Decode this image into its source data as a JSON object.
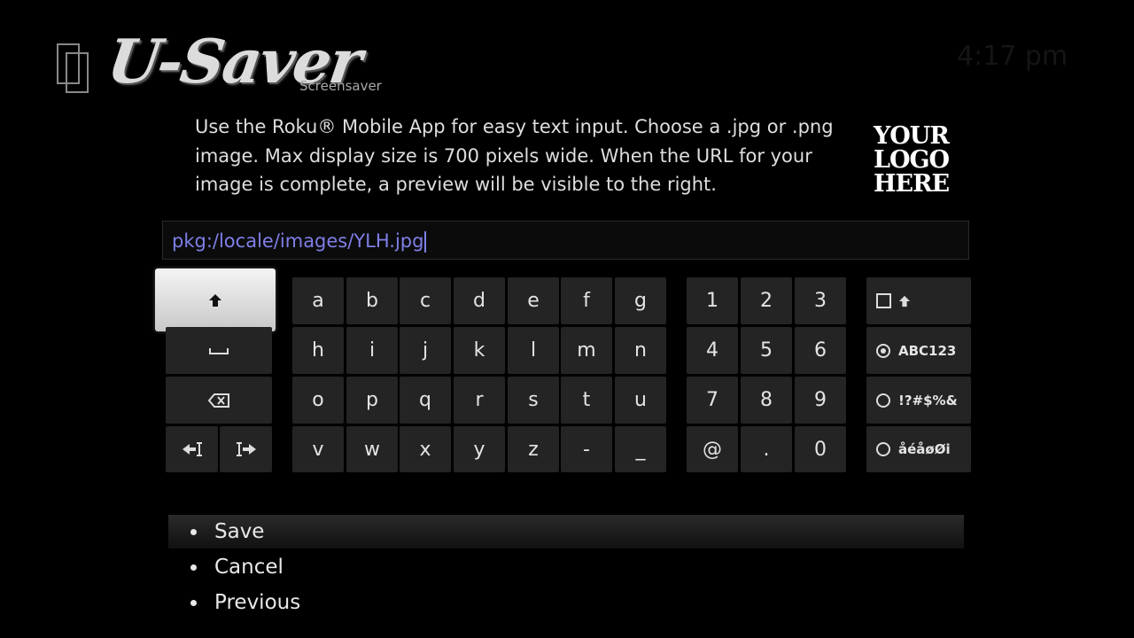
{
  "header": {
    "title": "U-Saver",
    "subtitle": "Screensaver",
    "clock": "4:17 pm"
  },
  "description": "Use the Roku® Mobile App for easy text input. Choose a .jpg or .png image. Max display size is 700 pixels wide. When the URL for your image is complete, a preview will be visible to the right.",
  "preview": {
    "lines": [
      "YOUR",
      "LOGO",
      "HERE"
    ]
  },
  "url_input": {
    "value": "pkg:/locale/images/YLH.jpg"
  },
  "keyboard": {
    "control_keys": {
      "shift": "⬆",
      "space": "⎵",
      "backspace": "⌫",
      "cursor_left": "⇤",
      "cursor_right": "⇥"
    },
    "letters": [
      [
        "a",
        "b",
        "c",
        "d",
        "e",
        "f",
        "g"
      ],
      [
        "h",
        "i",
        "j",
        "k",
        "l",
        "m",
        "n"
      ],
      [
        "o",
        "p",
        "q",
        "r",
        "s",
        "t",
        "u"
      ],
      [
        "v",
        "w",
        "x",
        "y",
        "z",
        "-",
        "_"
      ]
    ],
    "numbers": [
      [
        "1",
        "2",
        "3"
      ],
      [
        "4",
        "5",
        "6"
      ],
      [
        "7",
        "8",
        "9"
      ],
      [
        "@",
        ".",
        "0"
      ]
    ],
    "modes": {
      "caps_lock": "⬆",
      "alnum": "ABC123",
      "symbols": "!?#$%&",
      "accents": "åéåøØi"
    },
    "focused_key": "shift",
    "selected_mode": "alnum"
  },
  "menu": {
    "items": [
      "Save",
      "Cancel",
      "Previous"
    ],
    "selected": "Save"
  },
  "colors": {
    "background": "#000000",
    "key": "#242424",
    "focused_key": "#e0e0e0",
    "url_text": "#7f7fe8"
  }
}
